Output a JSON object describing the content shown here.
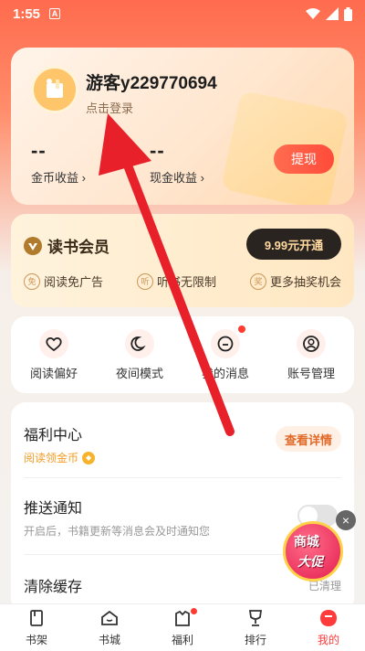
{
  "status_bar": {
    "time": "1:55",
    "notification_icon": "A"
  },
  "profile": {
    "username": "游客y229770694",
    "login_link": "点击登录",
    "coin_value": "--",
    "coin_label": "金币收益",
    "cash_value": "--",
    "cash_label": "现金收益",
    "withdraw_label": "提现"
  },
  "vip": {
    "title": "读书会员",
    "open_label": "9.99元开通",
    "perks": [
      {
        "icon": "免",
        "label": "阅读免广告"
      },
      {
        "icon": "听",
        "label": "听书无限制"
      },
      {
        "icon": "奖",
        "label": "更多抽奖机会"
      }
    ]
  },
  "quick_actions": [
    {
      "label": "阅读偏好",
      "icon": "heart-icon"
    },
    {
      "label": "夜间模式",
      "icon": "moon-icon"
    },
    {
      "label": "我的消息",
      "icon": "message-icon"
    },
    {
      "label": "账号管理",
      "icon": "user-icon"
    }
  ],
  "settings": {
    "welfare_title": "福利中心",
    "welfare_sub": "阅读领金币",
    "welfare_button": "查看详情",
    "push_title": "推送通知",
    "push_sub": "开启后，书籍更新等消息会及时通知您",
    "cache_title": "清除缓存",
    "cache_value": "已清理"
  },
  "promo": {
    "line1": "商城",
    "line2": "大促"
  },
  "tabs": [
    {
      "label": "书架",
      "icon": "bookshelf-icon"
    },
    {
      "label": "书城",
      "icon": "bookstore-icon"
    },
    {
      "label": "福利",
      "icon": "gift-icon"
    },
    {
      "label": "排行",
      "icon": "trophy-icon"
    },
    {
      "label": "我的",
      "icon": "profile-icon"
    }
  ],
  "colors": {
    "accent": "#ff3b3b",
    "arrow": "#e8202a"
  }
}
